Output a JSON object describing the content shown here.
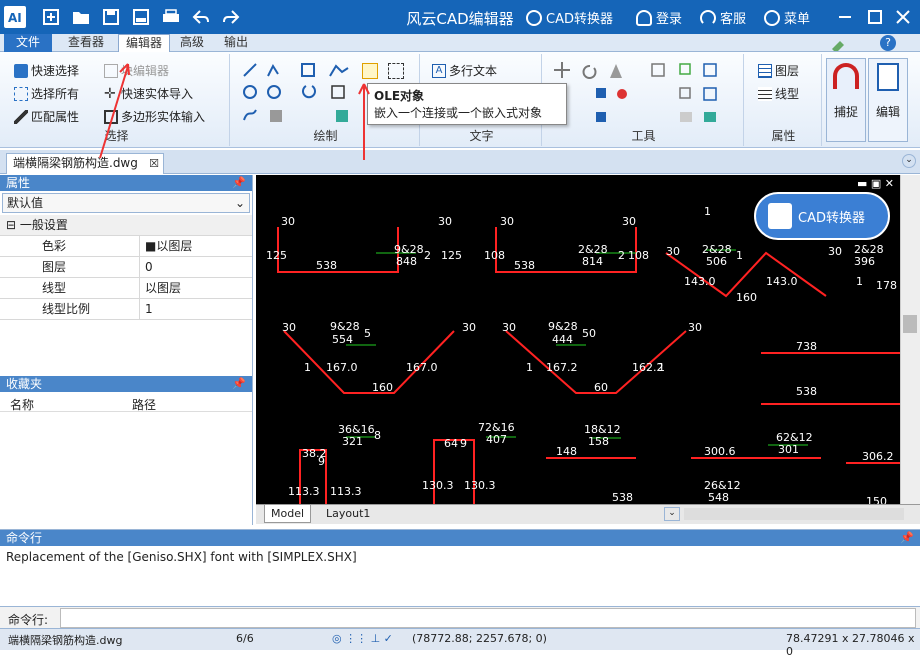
{
  "app": {
    "title": "风云CAD编辑器",
    "topright": {
      "converter": "CAD转换器",
      "login": "登录",
      "service": "客服",
      "menu": "菜单"
    }
  },
  "menubar": {
    "tabs": [
      "文件",
      "查看器",
      "编辑器",
      "高级",
      "输出"
    ],
    "active": "编辑器"
  },
  "ribbon": {
    "select_group": {
      "label": "选择",
      "items": [
        "快速选择",
        "选择所有",
        "匹配属性"
      ],
      "items2": [
        "块编辑器",
        "快速实体导入",
        "多边形实体输入"
      ]
    },
    "draw_group": {
      "label": "绘制"
    },
    "text_group": {
      "label": "文字",
      "mtext": "多行文本"
    },
    "tools_group": {
      "label": "工具"
    },
    "props_group": {
      "label": "属性",
      "layer": "图层",
      "linetype": "线型"
    },
    "snap": "捕捉",
    "edit": "编辑"
  },
  "tooltip": {
    "title": "OLE对象",
    "desc": "嵌入一个连接或一个嵌入式对象"
  },
  "document": {
    "tab": "端横隔梁钢筋构造.dwg"
  },
  "properties": {
    "header": "属性",
    "select": "默认值",
    "section": "一般设置",
    "rows": [
      {
        "k": "色彩",
        "v": "■以图层"
      },
      {
        "k": "图层",
        "v": "0"
      },
      {
        "k": "线型",
        "v": "以图层"
      },
      {
        "k": "线型比例",
        "v": "1"
      }
    ]
  },
  "favorites": {
    "header": "收藏夹",
    "cols": [
      "名称",
      "路径"
    ]
  },
  "layout_tabs": [
    "Model",
    "Layout1"
  ],
  "converter_button": "CAD转换器",
  "command": {
    "header": "命令行",
    "output": "Replacement of the [Geniso.SHX] font with [SIMPLEX.SHX]",
    "prompt": "命令行:"
  },
  "status": {
    "file": "端横隔梁钢筋构造.dwg",
    "pages": "6/6",
    "coords": "(78772.88; 2257.678; 0)",
    "size": "78.47291 x 27.78046 x 0"
  },
  "drawing": {
    "labels": [
      "30",
      "30",
      "125",
      "125",
      "538",
      "9&28",
      "848",
      "2",
      "30",
      "30",
      "108",
      "108",
      "538",
      "2&28",
      "814",
      "2",
      "30",
      "2&28",
      "506",
      "1",
      "143.0",
      "160",
      "143.0",
      "30",
      "2&28",
      "396",
      "1",
      "178",
      "30",
      "9&28",
      "554",
      "5",
      "30",
      "167.0",
      "160",
      "167.0",
      "1",
      "30",
      "9&28",
      "444",
      "50",
      "30",
      "167.2",
      "60",
      "162.2",
      "1",
      "1",
      "738",
      "538",
      "36&16",
      "321",
      "8",
      "38.2",
      "9",
      "113.3",
      "113.3",
      "72&16",
      "407",
      "64",
      "130.3",
      "130.3",
      "9",
      "18&12",
      "158",
      "148",
      "62&12",
      "301",
      "300.6",
      "306.2",
      "26&12",
      "548",
      "538",
      "150",
      "1"
    ]
  }
}
